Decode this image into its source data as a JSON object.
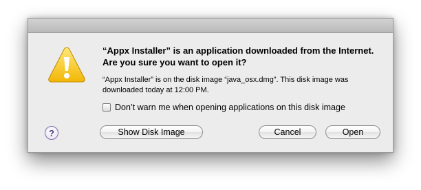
{
  "dialog": {
    "title": "“Appx Installer” is an application downloaded from the Internet. Are you sure you want to open it?",
    "info": "“Appx Installer” is on the disk image “java_osx.dmg”. This disk image was downloaded today at 12:00 PM.",
    "checkbox_label": "Don’t warn me when opening applications on this disk image",
    "checkbox_checked": false,
    "help_label": "?",
    "buttons": {
      "show_disk_image": "Show Disk Image",
      "cancel": "Cancel",
      "open": "Open"
    },
    "icon": "warning-triangle-icon"
  }
}
